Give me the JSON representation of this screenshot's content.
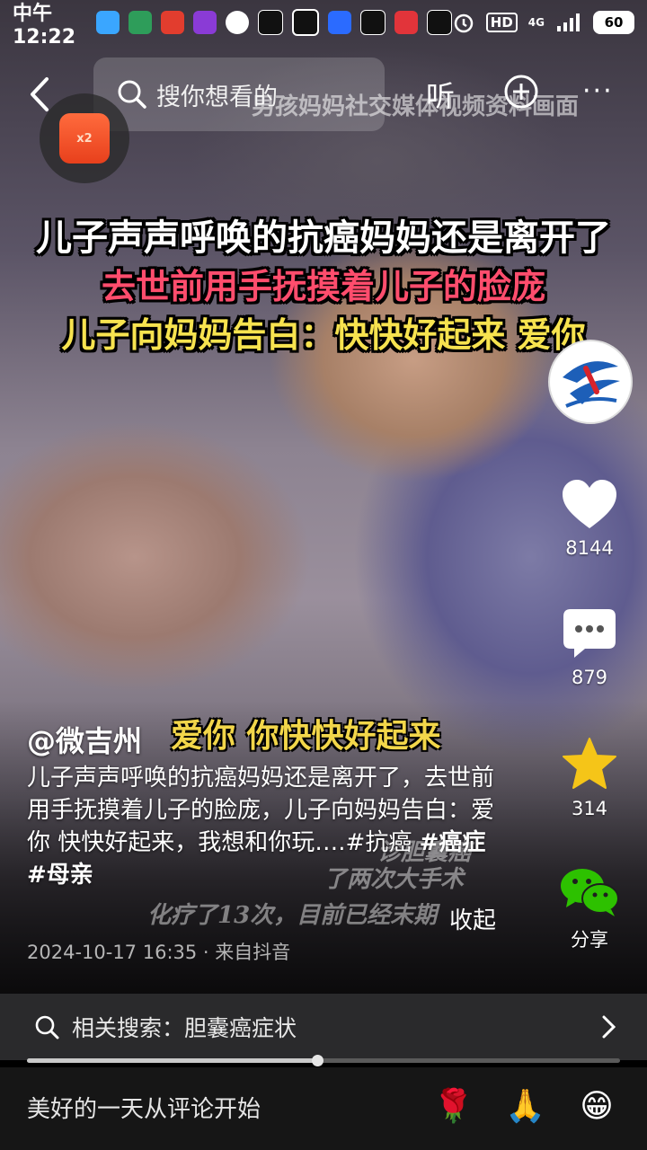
{
  "status_bar": {
    "time": "中午12:22",
    "network": "4G",
    "battery": "60"
  },
  "top_bar": {
    "search_placeholder": "搜你想看的",
    "listen_label": "听",
    "more_label": "···"
  },
  "video": {
    "watermark": "男孩妈妈社交媒体视频资料画面",
    "headline_1": "儿子声声呼唤的抗癌妈妈还是离开了",
    "headline_2": "去世前用手抚摸着儿子的脸庞",
    "headline_3": "儿子向妈妈告白：快快好起来 爱你",
    "caption_overlay": "爱你 你快快好起来",
    "subtitle_bg_1": "诊胆囊癌",
    "subtitle_bg_2": "化疗了13次，目前已经末期",
    "subtitle_bg_3": "了两次大手术",
    "reward_label": "x2"
  },
  "actions": {
    "like_count": "8144",
    "comment_count": "879",
    "favorite_count": "314",
    "share_label": "分享"
  },
  "post": {
    "author": "@微吉州",
    "description_text": "儿子声声呼唤的抗癌妈妈还是离开了，去世前用手抚摸着儿子的脸庞，儿子向妈妈告白：爱你 快快好起来，我想和你玩….#抗癌 ",
    "tag_1": "#癌症",
    "tag_2": "#母亲",
    "collapse_label": "收起",
    "meta": "2024-10-17 16:35 · 来自抖音"
  },
  "related_search": {
    "label": "相关搜索：胆囊癌症状"
  },
  "playback": {
    "progress": 0.49
  },
  "comment_bar": {
    "placeholder": "美好的一天从评论开始",
    "emoji_1": "🌹",
    "emoji_2": "🙏",
    "emoji_3": "😁"
  },
  "colors": {
    "headline_red": "#ff4d6d",
    "headline_yellow": "#f7e34f",
    "favorite_star": "#f5c518",
    "share_green": "#2dc100"
  }
}
